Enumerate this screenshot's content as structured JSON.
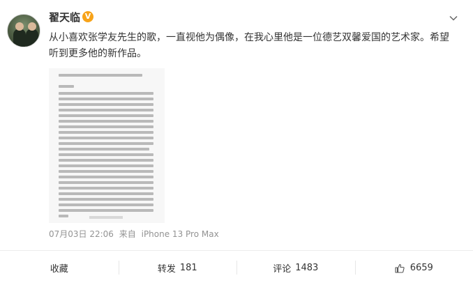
{
  "post": {
    "author": "翟天临",
    "vip_badge": "V",
    "text_line1": "从小喜欢张学友先生的歌，一直视他为偶像，在我心里他是一位德艺双馨爱国的艺术家。希望",
    "text_line2": "听到更多他的新作品。",
    "time": "07月03日 22:06",
    "source_prefix": "来自",
    "source": "iPhone 13 Pro Max"
  },
  "actions": {
    "favorite_label": "收藏",
    "repost_label": "转发",
    "repost_count": "181",
    "comment_label": "评论",
    "comment_count": "1483",
    "like_count": "6659"
  },
  "colors": {
    "vip_badge": "#f7a319",
    "meta_text": "#939393"
  }
}
